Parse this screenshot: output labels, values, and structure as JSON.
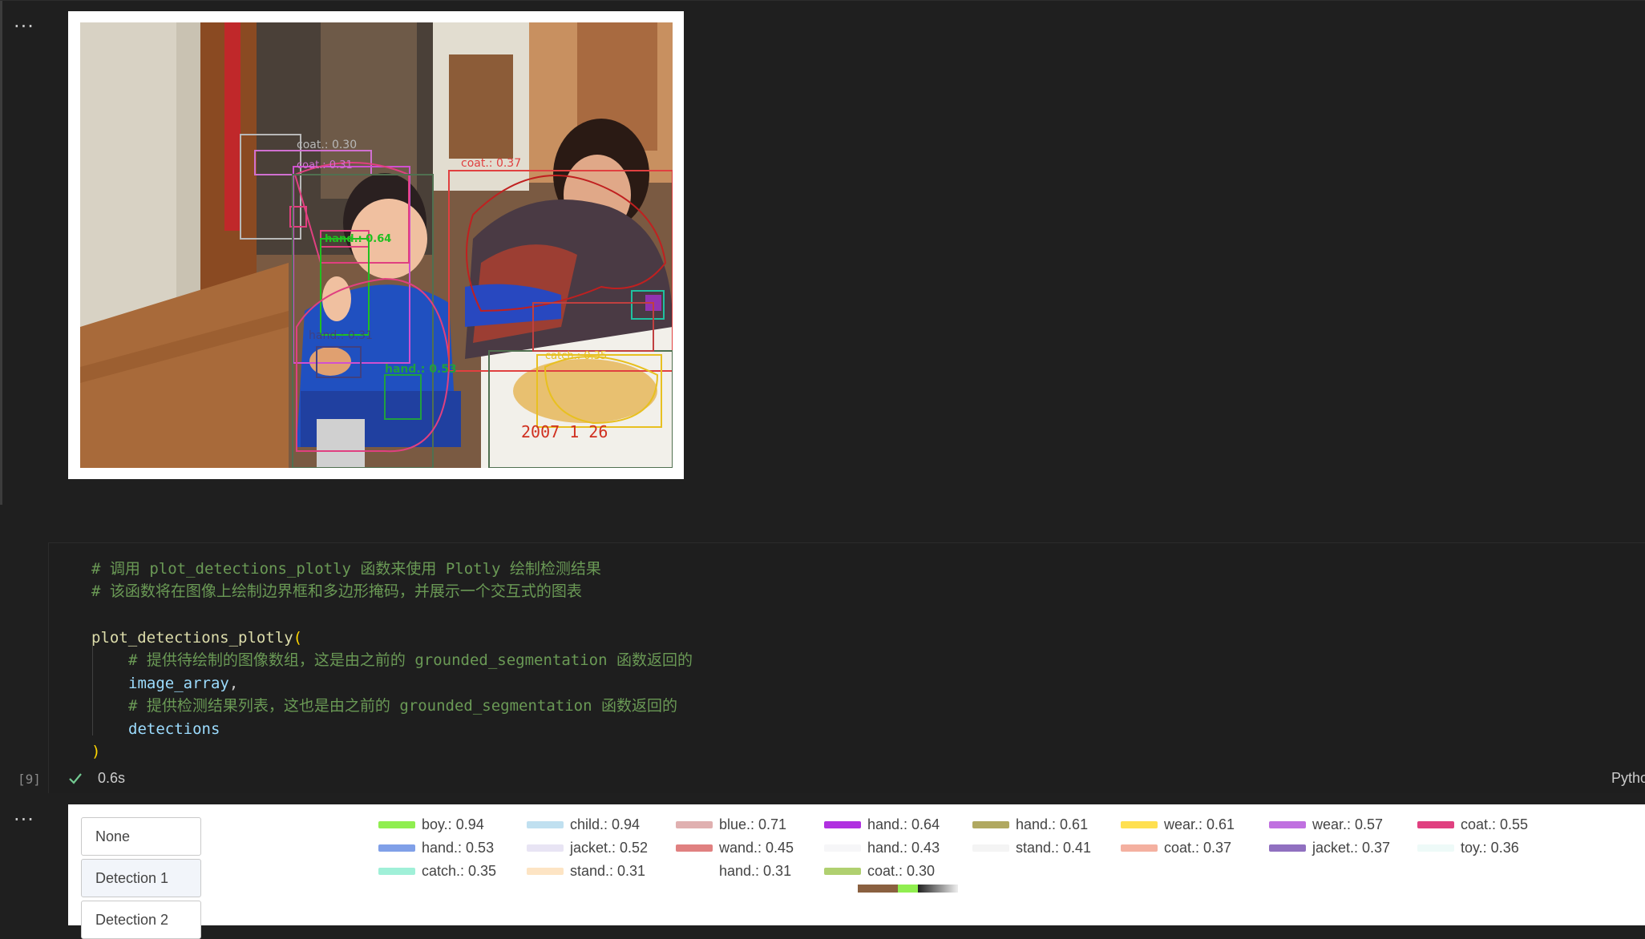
{
  "gutter": {
    "ellipsis_top": "...",
    "ellipsis_bottom": "..."
  },
  "output_image": {
    "labels": [
      {
        "text": "coat.: 0.30",
        "color": "#b8b8b8"
      },
      {
        "text": "coat.: 0.31",
        "color": "#d070d0"
      },
      {
        "text": "coat.: 0.37",
        "color": "#e04040"
      },
      {
        "text": "hand.: 0.31",
        "color": "#404080"
      },
      {
        "text": "hand.: 0.53",
        "color": "#20a040"
      },
      {
        "text": "hand.: 0.64",
        "color": "#20c020"
      },
      {
        "text": "catch.: 0.35",
        "color": "#e8c020"
      },
      {
        "text": "2007  1 26",
        "color": "#d03020"
      }
    ]
  },
  "code_cell": {
    "lines": [
      {
        "type": "comment",
        "text": "# 调用 plot_detections_plotly 函数来使用 Plotly 绘制检测结果"
      },
      {
        "type": "comment",
        "text": "# 该函数将在图像上绘制边界框和多边形掩码，并展示一个交互式的图表"
      },
      {
        "type": "blank",
        "text": ""
      },
      {
        "type": "call",
        "func": "plot_detections_plotly",
        "paren": "("
      },
      {
        "type": "comment",
        "text": "# 提供待绘制的图像数组，这是由之前的 grounded_segmentation 函数返回的"
      },
      {
        "type": "arg",
        "var": "image_array",
        "punct": ","
      },
      {
        "type": "comment",
        "text": "# 提供检测结果列表，这也是由之前的 grounded_segmentation 函数返回的"
      },
      {
        "type": "arg",
        "var": "detections",
        "punct": ""
      },
      {
        "type": "close",
        "paren": ")"
      }
    ],
    "execution_count": "[9]",
    "exec_time": "0.6s",
    "language": "Pytho"
  },
  "plot": {
    "buttons": [
      {
        "label": "None"
      },
      {
        "label": "Detection 1"
      },
      {
        "label": "Detection 2"
      }
    ],
    "legend": [
      {
        "label": "boy.: 0.94",
        "color": "#90ee50"
      },
      {
        "label": "child.: 0.94",
        "color": "#c0e0f0"
      },
      {
        "label": "blue.: 0.71",
        "color": "#e0b0b0"
      },
      {
        "label": "hand.: 0.64",
        "color": "#b030e0"
      },
      {
        "label": "hand.: 0.61",
        "color": "#b0a860"
      },
      {
        "label": "wear.: 0.61",
        "color": "#ffe050"
      },
      {
        "label": "wear.: 0.57",
        "color": "#c070e0"
      },
      {
        "label": "coat.: 0.55",
        "color": "#e04080"
      },
      {
        "label": "hand.: 0.53",
        "color": "#80a0e8"
      },
      {
        "label": "jacket.: 0.52",
        "color": "#e8e4f4"
      },
      {
        "label": "wand.: 0.45",
        "color": "#e08080"
      },
      {
        "label": "hand.: 0.43",
        "color": "#f6f6f8"
      },
      {
        "label": "stand.: 0.41",
        "color": "#f4f4f4"
      },
      {
        "label": "coat.: 0.37",
        "color": "#f4b0a0"
      },
      {
        "label": "jacket.: 0.37",
        "color": "#9070c0"
      },
      {
        "label": "toy.: 0.36",
        "color": "#eefaf8"
      },
      {
        "label": "catch.: 0.35",
        "color": "#a0f0d8"
      },
      {
        "label": "stand.: 0.31",
        "color": "#fde4c4"
      },
      {
        "label": "hand.: 0.31",
        "color": "#ffffff"
      },
      {
        "label": "coat.: 0.30",
        "color": "#b0d070"
      }
    ]
  }
}
